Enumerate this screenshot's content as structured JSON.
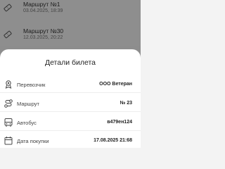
{
  "tickets": [
    {
      "title": "Маршрут №1",
      "date": "03.04.2025, 18:39",
      "icon": "ticket-icon"
    },
    {
      "title": "Маршрут №30",
      "date": "12.03.2025, 20:22",
      "icon": "ticket-icon"
    }
  ],
  "sheet": {
    "title": "Детали билета",
    "rows": [
      {
        "label": "Перевозчик",
        "value": "ООО Ветеран",
        "icon": "carrier-icon"
      },
      {
        "label": "Маршрут",
        "value": "№ 23",
        "icon": "route-icon"
      },
      {
        "label": "Автобус",
        "value": "в479ен124",
        "icon": "bus-icon"
      },
      {
        "label": "Дата покупки",
        "value": "17.08.2025 21:68",
        "icon": "calendar-icon"
      }
    ]
  },
  "colors": {
    "overlay": "#0000006b",
    "sheet": "#ffffff",
    "text": "#222222"
  }
}
